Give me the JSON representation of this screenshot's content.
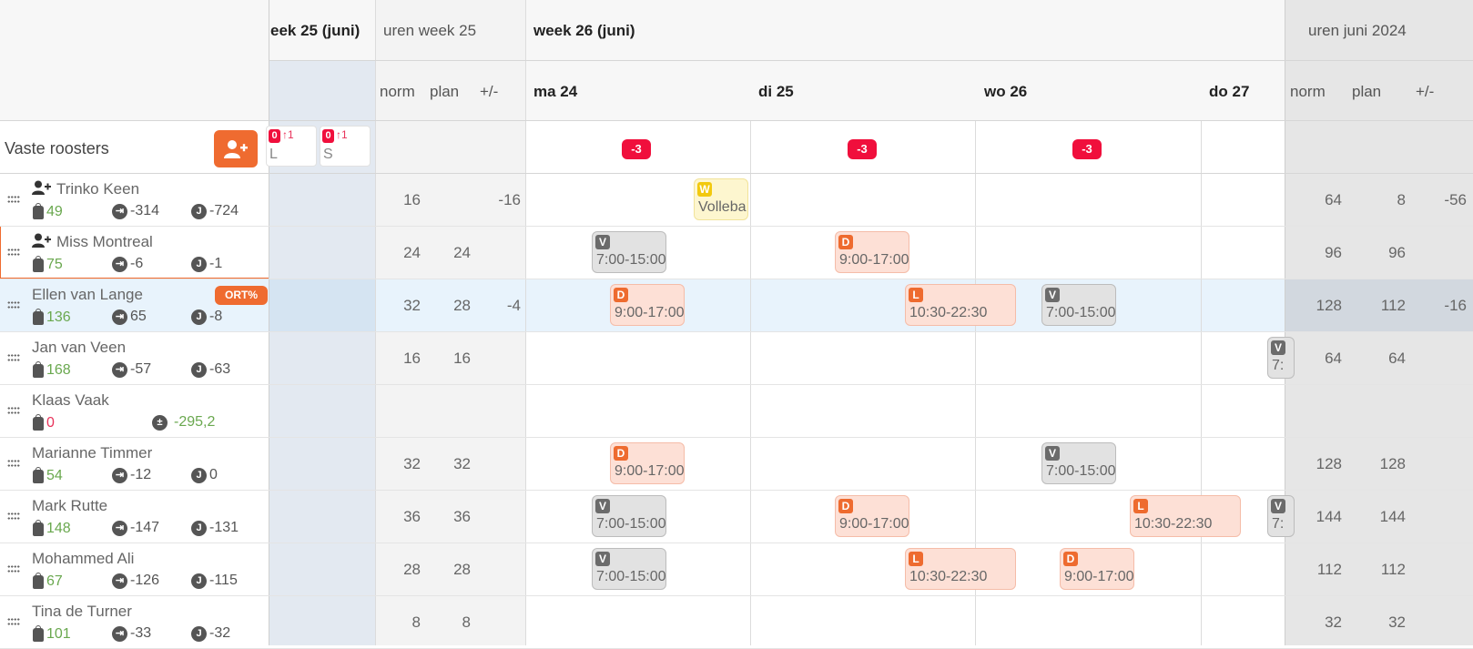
{
  "header": {
    "week25_title": "eek 25 (juni)",
    "uren_week25": "uren week 25",
    "week26_title": "week 26 (juni)",
    "uren_month": "uren juni 2024",
    "col_norm": "norm",
    "col_plan": "plan",
    "col_diff": "+/-",
    "days": [
      "ma 24",
      "di 25",
      "wo 26",
      "do 27"
    ]
  },
  "section": {
    "title": "Vaste roosters",
    "add_icon": "add-user-icon",
    "minicards": [
      {
        "count": "0",
        "up": "↑1",
        "label": "L"
      },
      {
        "count": "0",
        "up": "↑1",
        "label": "S"
      }
    ],
    "day_badges": [
      "-3",
      "-3",
      "-3"
    ]
  },
  "employees": [
    {
      "name": "Trinko Keen",
      "new": true,
      "bag": "49",
      "bag_color": "green",
      "transfer": "-314",
      "j": "-724",
      "w_norm": "16",
      "w_plan": "",
      "w_diff": "-16",
      "m_norm": "64",
      "m_plan": "8",
      "m_diff": "-56"
    },
    {
      "name": "Miss Montreal",
      "new": true,
      "bag": "75",
      "bag_color": "green",
      "transfer": "-6",
      "j": "-1",
      "w_norm": "24",
      "w_plan": "24",
      "w_diff": "",
      "m_norm": "96",
      "m_plan": "96",
      "m_diff": ""
    },
    {
      "name": "Ellen van Lange",
      "new": false,
      "bag": "136",
      "bag_color": "green",
      "transfer": "65",
      "j": "-8",
      "badge": "ORT%",
      "w_norm": "32",
      "w_plan": "28",
      "w_diff": "-4",
      "m_norm": "128",
      "m_plan": "112",
      "m_diff": "-16"
    },
    {
      "name": "Jan van Veen",
      "new": false,
      "bag": "168",
      "bag_color": "green",
      "transfer": "-57",
      "j": "-63",
      "w_norm": "16",
      "w_plan": "16",
      "w_diff": "",
      "m_norm": "64",
      "m_plan": "64",
      "m_diff": ""
    },
    {
      "name": "Klaas Vaak",
      "new": false,
      "bag": "0",
      "bag_color": "red",
      "plusminus": "-295,2",
      "w_norm": "",
      "w_plan": "",
      "w_diff": "",
      "m_norm": "",
      "m_plan": "",
      "m_diff": ""
    },
    {
      "name": "Marianne Timmer",
      "new": false,
      "bag": "54",
      "bag_color": "green",
      "transfer": "-12",
      "j": "0",
      "w_norm": "32",
      "w_plan": "32",
      "w_diff": "",
      "m_norm": "128",
      "m_plan": "128",
      "m_diff": ""
    },
    {
      "name": "Mark Rutte",
      "new": false,
      "bag": "148",
      "bag_color": "green",
      "transfer": "-147",
      "j": "-131",
      "w_norm": "36",
      "w_plan": "36",
      "w_diff": "",
      "m_norm": "144",
      "m_plan": "144",
      "m_diff": ""
    },
    {
      "name": "Mohammed Ali",
      "new": false,
      "bag": "67",
      "bag_color": "green",
      "transfer": "-126",
      "j": "-115",
      "w_norm": "28",
      "w_plan": "28",
      "w_diff": "",
      "m_norm": "112",
      "m_plan": "112",
      "m_diff": ""
    },
    {
      "name": "Tina de Turner",
      "new": false,
      "bag": "101",
      "bag_color": "green",
      "transfer": "-33",
      "j": "-32",
      "w_norm": "8",
      "w_plan": "8",
      "w_diff": "",
      "m_norm": "32",
      "m_plan": "32",
      "m_diff": ""
    }
  ],
  "shifts": [
    {
      "row": 0,
      "day": 0,
      "type": "W",
      "text": "Volleba",
      "style": "w",
      "slot": "late"
    },
    {
      "row": 1,
      "day": 0,
      "type": "V",
      "text": "7:00-15:00",
      "style": "v",
      "slot": "early"
    },
    {
      "row": 1,
      "day": 1,
      "type": "D",
      "text": "9:00-17:00",
      "style": "d",
      "slot": "mid"
    },
    {
      "row": 2,
      "day": 0,
      "type": "D",
      "text": "9:00-17:00",
      "style": "d",
      "slot": "mid"
    },
    {
      "row": 2,
      "day": 1,
      "type": "L",
      "text": "10:30-22:30",
      "style": "d",
      "slot": "late"
    },
    {
      "row": 2,
      "day": 2,
      "type": "V",
      "text": "7:00-15:00",
      "style": "v",
      "slot": "early"
    },
    {
      "row": 3,
      "day": 3,
      "type": "V",
      "text": "7:",
      "style": "v",
      "slot": "edge"
    },
    {
      "row": 5,
      "day": 0,
      "type": "D",
      "text": "9:00-17:00",
      "style": "d",
      "slot": "mid"
    },
    {
      "row": 5,
      "day": 2,
      "type": "V",
      "text": "7:00-15:00",
      "style": "v",
      "slot": "early"
    },
    {
      "row": 6,
      "day": 0,
      "type": "V",
      "text": "7:00-15:00",
      "style": "v",
      "slot": "early"
    },
    {
      "row": 6,
      "day": 1,
      "type": "D",
      "text": "9:00-17:00",
      "style": "d",
      "slot": "mid"
    },
    {
      "row": 6,
      "day": 2,
      "type": "L",
      "text": "10:30-22:30",
      "style": "d",
      "slot": "late"
    },
    {
      "row": 6,
      "day": 3,
      "type": "V",
      "text": "7:",
      "style": "v",
      "slot": "edge"
    },
    {
      "row": 7,
      "day": 0,
      "type": "V",
      "text": "7:00-15:00",
      "style": "v",
      "slot": "early"
    },
    {
      "row": 7,
      "day": 1,
      "type": "L",
      "text": "10:30-22:30",
      "style": "d",
      "slot": "late"
    },
    {
      "row": 7,
      "day": 2,
      "type": "D",
      "text": "9:00-17:00",
      "style": "d",
      "slot": "mid"
    }
  ]
}
